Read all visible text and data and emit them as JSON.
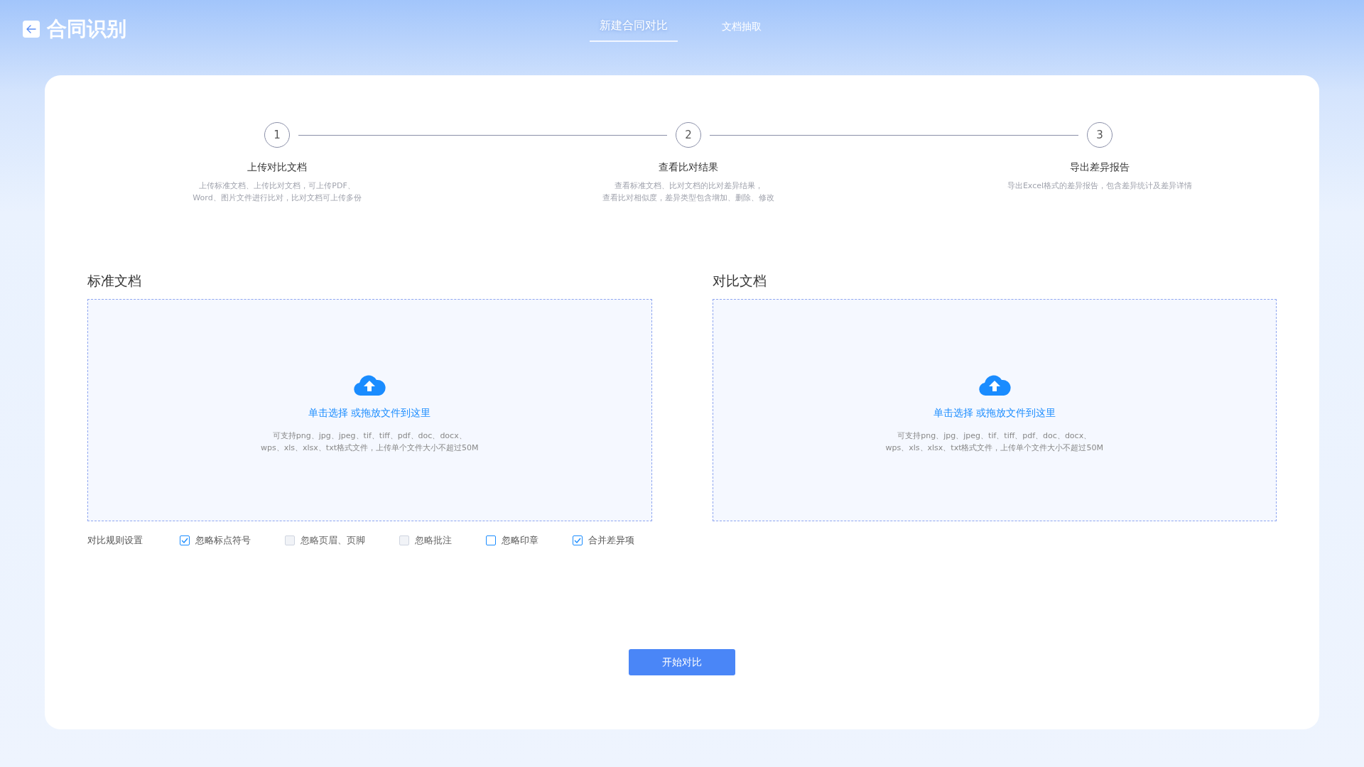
{
  "header": {
    "title": "合同识别",
    "tabs": [
      {
        "label": "新建合同对比",
        "selected": true
      },
      {
        "label": "文档抽取",
        "selected": false
      }
    ]
  },
  "steps": [
    {
      "number": "1",
      "title": "上传对比文档",
      "description": [
        "上传标准文档、上传比对文档，可上传PDF、",
        "Word、图片文件进行比对，比对文档可上传多份"
      ]
    },
    {
      "number": "2",
      "title": "查看比对结果",
      "description": [
        "查看标准文档、比对文档的比对差异结果，",
        "查看比对相似度，差异类型包含增加、删除、修改"
      ]
    },
    {
      "number": "3",
      "title": "导出差异报告",
      "description": [
        "导出Excel格式的差异报告，包含差异统计及差异详情"
      ]
    }
  ],
  "uploads": [
    {
      "title": "标准文档",
      "action": "单击选择 或拖放文件到这里",
      "hint": [
        "可支持png、jpg、jpeg、tif、tiff、pdf、doc、docx、",
        "wps、xls、xlsx、txt格式文件，上传单个文件大小不超过50M"
      ]
    },
    {
      "title": "对比文档",
      "action": "单击选择 或拖放文件到这里",
      "hint": [
        "可支持png、jpg、jpeg、tif、tiff、pdf、doc、docx、",
        "wps、xls、xlsx、txt格式文件，上传单个文件大小不超过50M"
      ]
    }
  ],
  "rules": {
    "label": "对比规则设置",
    "options": [
      {
        "label": "忽略标点符号",
        "checked": true,
        "disabled": false
      },
      {
        "label": "忽略页眉、页脚",
        "checked": false,
        "disabled": true
      },
      {
        "label": "忽略批注",
        "checked": false,
        "disabled": true
      },
      {
        "label": "忽略印章",
        "checked": false,
        "disabled": false
      },
      {
        "label": "合并差异项",
        "checked": true,
        "disabled": false
      }
    ]
  },
  "start_button": "开始对比"
}
